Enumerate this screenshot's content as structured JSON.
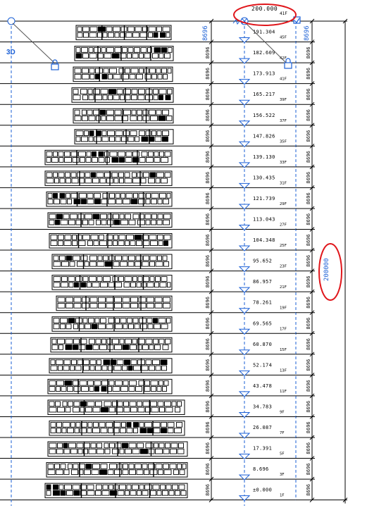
{
  "view": {
    "view_label": "3D",
    "colors": {
      "level_line": "#000000",
      "grid_blue": "#1a5fd6",
      "highlight_red": "#e0161b",
      "lock_blue": "#1a5fd6",
      "building": "#000000",
      "label_text": "#000000"
    }
  },
  "top_level": {
    "elevation": "200.000",
    "tag": "41F"
  },
  "overall_dimension": {
    "value": "200000"
  },
  "top_dimension": {
    "value": "8696"
  },
  "floor_dimension_value": "8696",
  "levels": [
    {
      "elevation": "191.304",
      "tag": "45F"
    },
    {
      "elevation": "182.609",
      "tag": "42F"
    },
    {
      "elevation": "173.913",
      "tag": "41F"
    },
    {
      "elevation": "165.217",
      "tag": "39F"
    },
    {
      "elevation": "156.522",
      "tag": "37F"
    },
    {
      "elevation": "147.826",
      "tag": "35F"
    },
    {
      "elevation": "139.130",
      "tag": "33F"
    },
    {
      "elevation": "130.435",
      "tag": "31F"
    },
    {
      "elevation": "121.739",
      "tag": "29F"
    },
    {
      "elevation": "113.043",
      "tag": "27F"
    },
    {
      "elevation": "104.348",
      "tag": "25F"
    },
    {
      "elevation": "95.652",
      "tag": "23F"
    },
    {
      "elevation": "86.957",
      "tag": "21F"
    },
    {
      "elevation": "78.261",
      "tag": "19F"
    },
    {
      "elevation": "69.565",
      "tag": "17F"
    },
    {
      "elevation": "60.870",
      "tag": "15F"
    },
    {
      "elevation": "52.174",
      "tag": "13F"
    },
    {
      "elevation": "43.478",
      "tag": "11F"
    },
    {
      "elevation": "34.783",
      "tag": "9F"
    },
    {
      "elevation": "26.087",
      "tag": "7F"
    },
    {
      "elevation": "17.391",
      "tag": "5F"
    },
    {
      "elevation": "8.696",
      "tag": "3F"
    },
    {
      "elevation": "±0.000",
      "tag": "1F"
    }
  ]
}
